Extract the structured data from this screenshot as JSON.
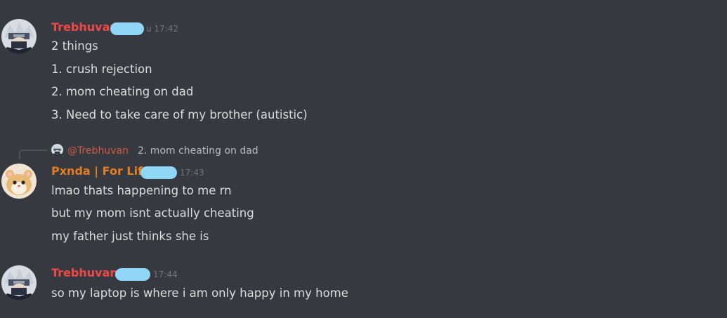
{
  "colors": {
    "background": "#36393f",
    "red_author": "#f04747",
    "orange_author": "#e67e22",
    "message_text": "#dcddde",
    "timestamp": "#72767d",
    "censor_blob": "#8fd6f7"
  },
  "messages": [
    {
      "author": "Trebhuvan",
      "timestamp": "u 17:42",
      "avatar_icon": "masked-ninja-avatar",
      "lines": [
        "2 things",
        "1. crush rejection",
        "2. mom cheating on dad",
        "3. Need to take care of my brother (autistic)"
      ]
    },
    {
      "reply": {
        "mention": "@Trebhuvan",
        "text": "2. mom cheating on dad",
        "avatar_icon": "masked-ninja-avatar"
      },
      "author": "Pxnda | For Life",
      "timestamp": "17:43",
      "avatar_icon": "hamster-avatar",
      "lines": [
        "lmao thats happening to me rn",
        "but my mom isnt actually cheating",
        "my father just thinks she is"
      ]
    },
    {
      "author": "Trebhuvan",
      "timestamp": "17:44",
      "avatar_icon": "masked-ninja-avatar",
      "lines": [
        "so my laptop is where i am only happy in my home"
      ]
    }
  ]
}
